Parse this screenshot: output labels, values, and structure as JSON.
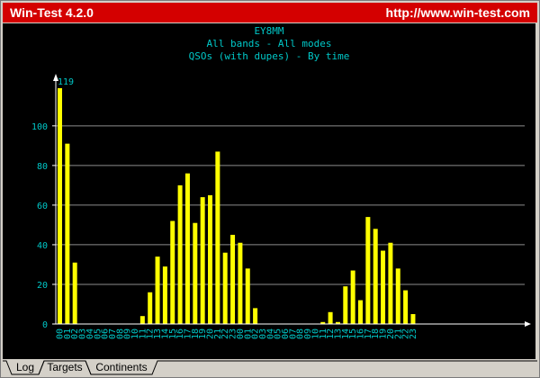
{
  "window": {
    "title": "Win-Test 4.2.0",
    "url": "http://www.win-test.com"
  },
  "tabs": [
    {
      "label": "Log"
    },
    {
      "label": "Targets"
    },
    {
      "label": "Continents"
    }
  ],
  "colors": {
    "titlebar": "#d40000",
    "background": "#000000",
    "axis_text": "#00c8c8",
    "bar": "#ffff00",
    "grid": "#8c8c8c",
    "axis": "#ffffff"
  },
  "chart_data": {
    "type": "bar",
    "title": [
      "EY8MM",
      "All bands - All modes",
      "QSOs (with dupes) - By time"
    ],
    "categories": [
      "00",
      "01",
      "02",
      "03",
      "04",
      "05",
      "06",
      "07",
      "08",
      "09",
      "10",
      "11",
      "12",
      "13",
      "14",
      "15",
      "16",
      "17",
      "18",
      "19",
      "20",
      "21",
      "22",
      "23",
      "00",
      "01",
      "02",
      "03",
      "04",
      "05",
      "06",
      "07",
      "08",
      "09",
      "10",
      "11",
      "12",
      "13",
      "14",
      "15",
      "16",
      "17",
      "18",
      "19",
      "20",
      "21",
      "22",
      "23"
    ],
    "values": [
      119,
      91,
      31,
      0,
      0,
      0,
      0,
      0,
      0,
      0,
      0,
      4,
      16,
      34,
      29,
      52,
      70,
      76,
      51,
      64,
      65,
      87,
      36,
      45,
      41,
      28,
      8,
      0,
      0,
      0,
      0,
      0,
      0,
      0,
      0,
      1,
      6,
      1,
      19,
      27,
      12,
      54,
      48,
      37,
      41,
      28,
      17,
      5
    ],
    "yticks": [
      0,
      20,
      40,
      60,
      80,
      100
    ],
    "ylim": [
      0,
      119
    ],
    "max_label": "119",
    "grid": true
  }
}
